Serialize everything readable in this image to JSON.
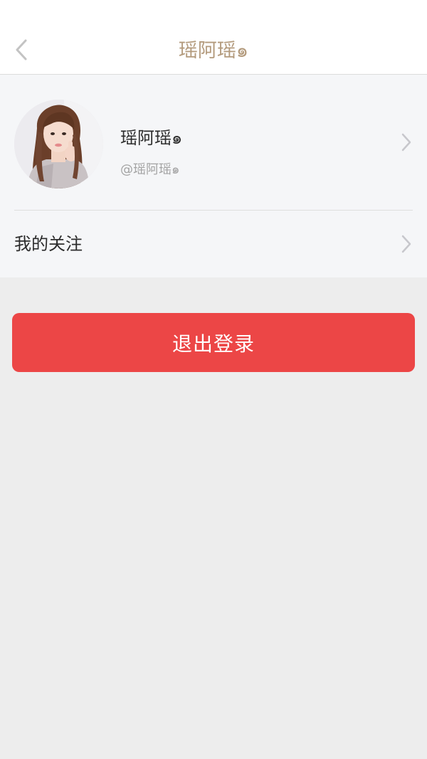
{
  "header": {
    "title": "瑶阿瑶๑",
    "back_icon": "chevron-left-icon"
  },
  "profile": {
    "name": "瑶阿瑶๑",
    "handle": "@瑶阿瑶๑",
    "avatar": "user-avatar-photo",
    "chevron_icon": "chevron-right-icon"
  },
  "menu": {
    "follow_label": "我的关注",
    "chevron_icon": "chevron-right-icon"
  },
  "actions": {
    "logout_label": "退出登录"
  },
  "colors": {
    "title": "#b39a7c",
    "logout_button": "#ec4646",
    "card_background": "#f5f6f8",
    "page_background": "#ededed"
  }
}
